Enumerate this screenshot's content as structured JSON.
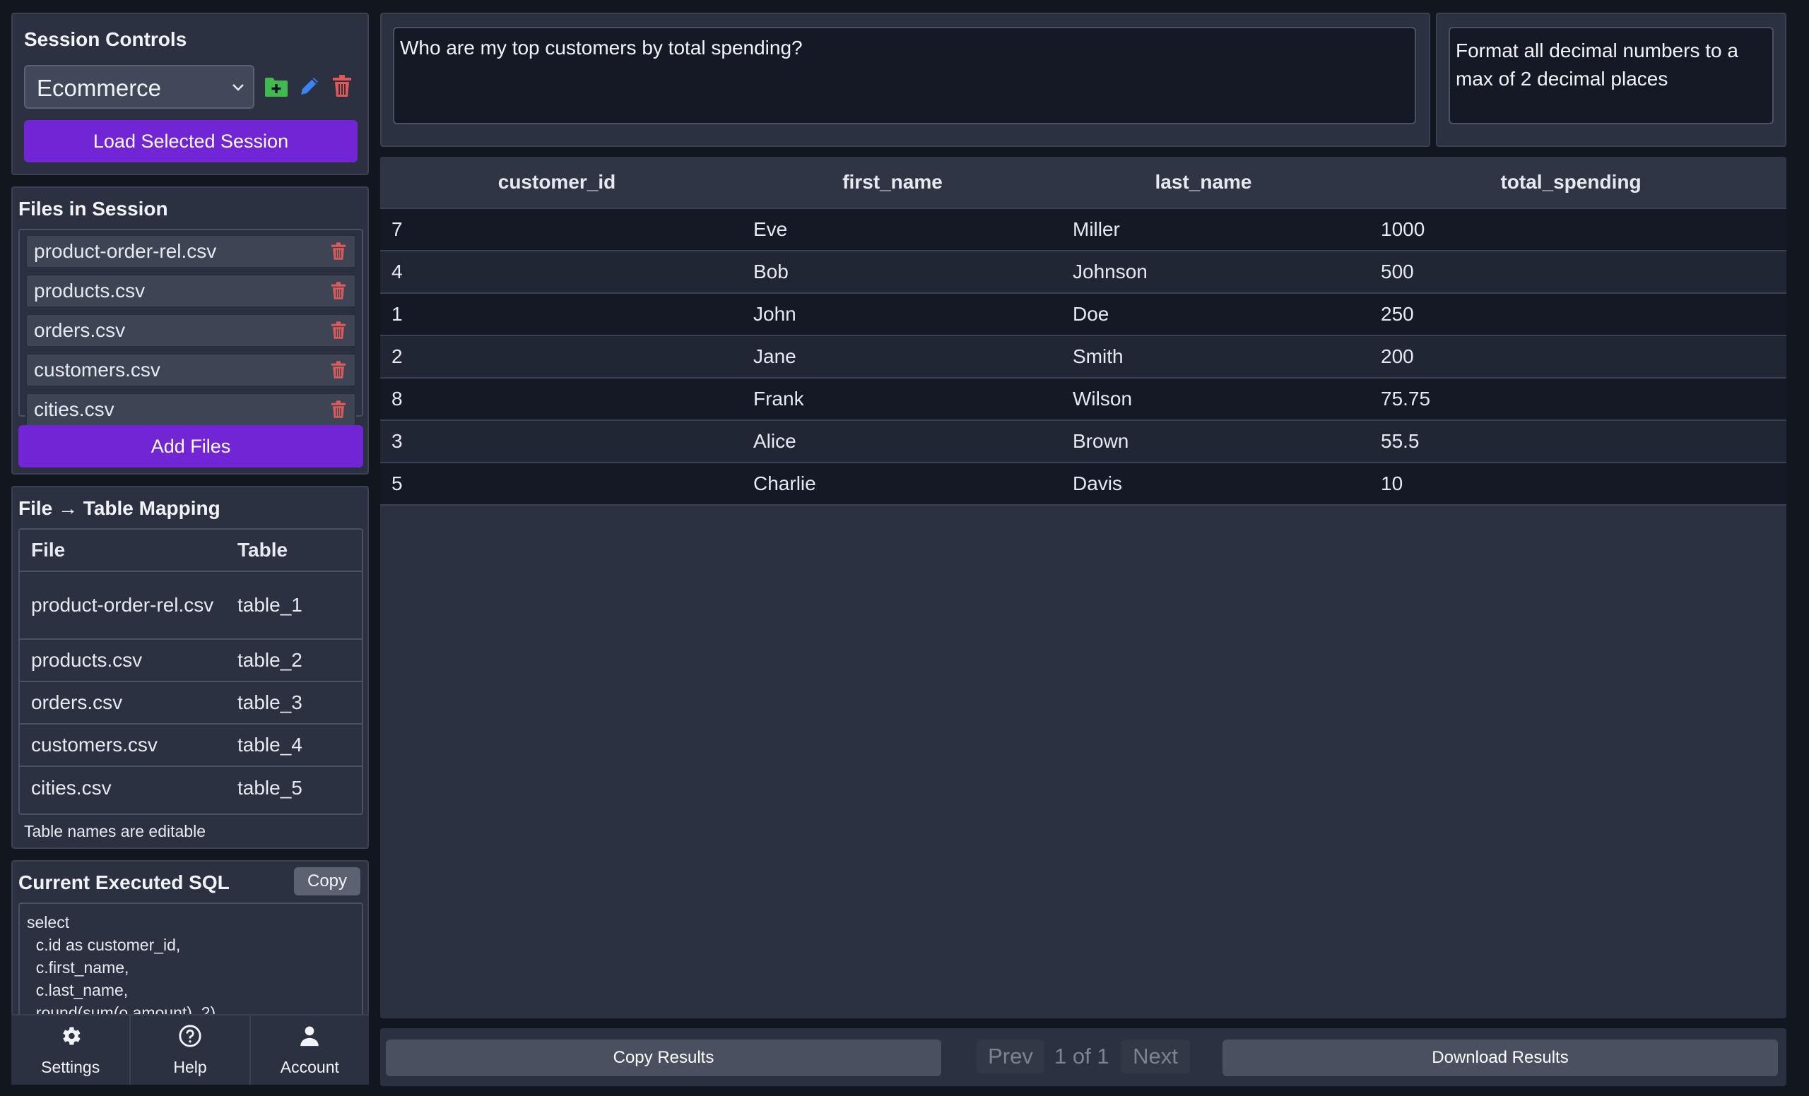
{
  "session": {
    "title": "Session Controls",
    "selected": "Ecommerce",
    "load_label": "Load Selected Session"
  },
  "files": {
    "title": "Files in Session",
    "items": [
      "product-order-rel.csv",
      "products.csv",
      "orders.csv",
      "customers.csv",
      "cities.csv"
    ],
    "add_label": "Add Files"
  },
  "mapping": {
    "title": "File → Table Mapping",
    "headers": {
      "file": "File",
      "table": "Table"
    },
    "rows": [
      {
        "file": "product-order-rel.csv",
        "table": "table_1"
      },
      {
        "file": "products.csv",
        "table": "table_2"
      },
      {
        "file": "orders.csv",
        "table": "table_3"
      },
      {
        "file": "customers.csv",
        "table": "table_4"
      },
      {
        "file": "cities.csv",
        "table": "table_5"
      }
    ],
    "note": "Table names are editable"
  },
  "sql": {
    "title": "Current Executed SQL",
    "copy_label": "Copy",
    "text": "select\n  c.id as customer_id,\n  c.first_name,\n  c.last_name,\n  round(sum(o.amount), 2)"
  },
  "bottom_nav": [
    {
      "label": "Settings",
      "icon": "gear-icon"
    },
    {
      "label": "Help",
      "icon": "help-icon"
    },
    {
      "label": "Account",
      "icon": "account-icon"
    }
  ],
  "query": {
    "text": "Who are my top customers by total spending?",
    "instruction": "Format all decimal numbers to a max of 2 decimal places"
  },
  "results": {
    "columns": [
      "customer_id",
      "first_name",
      "last_name",
      "total_spending"
    ],
    "rows": [
      [
        "7",
        "Eve",
        "Miller",
        "1000"
      ],
      [
        "4",
        "Bob",
        "Johnson",
        "500"
      ],
      [
        "1",
        "John",
        "Doe",
        "250"
      ],
      [
        "2",
        "Jane",
        "Smith",
        "200"
      ],
      [
        "8",
        "Frank",
        "Wilson",
        "75.75"
      ],
      [
        "3",
        "Alice",
        "Brown",
        "55.5"
      ],
      [
        "5",
        "Charlie",
        "Davis",
        "10"
      ]
    ]
  },
  "footer": {
    "copy_label": "Copy Results",
    "prev_label": "Prev",
    "page_text": "1 of 1",
    "next_label": "Next",
    "download_label": "Download Results"
  },
  "colors": {
    "accent": "#7125d4",
    "delete": "#e05a5a",
    "add": "#3fb950",
    "edit": "#3b82f6"
  }
}
